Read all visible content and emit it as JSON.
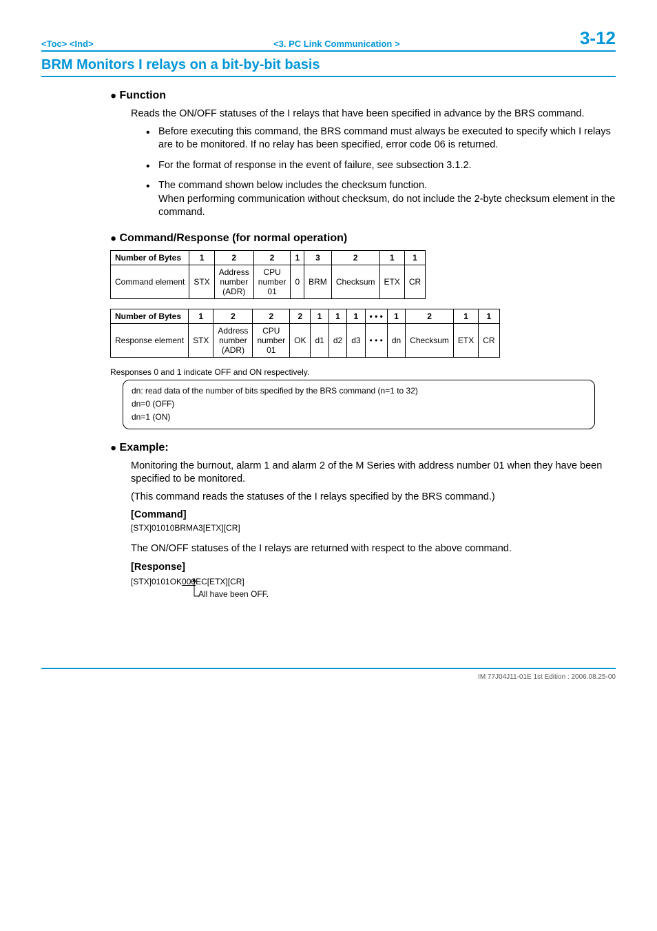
{
  "header": {
    "toc": "<Toc>",
    "ind": "<Ind>",
    "chapter": "<3.  PC Link Communication >",
    "pagenum": "3-12"
  },
  "title": "BRM   Monitors I relays on a bit-by-bit basis",
  "function": {
    "heading": "Function",
    "intro": "Reads the ON/OFF statuses of the I relays that have been specified in advance by the BRS command.",
    "bullets": [
      "Before executing this command, the BRS command must always be executed to specify which I relays are to be monitored. If no relay has been specified, error code 06 is returned.",
      "For the format of response in the event of failure, see subsection 3.1.2.",
      "The command shown below includes the checksum function.\nWhen performing communication without checksum, do not include the 2-byte checksum element in the command."
    ]
  },
  "cmdresp": {
    "heading": "Command/Response (for normal operation)",
    "command_table": {
      "nob_label": "Number of Bytes",
      "elem_label": "Command element",
      "cols": [
        {
          "bytes": "1",
          "val": "STX"
        },
        {
          "bytes": "2",
          "val": "Address number (ADR)"
        },
        {
          "bytes": "2",
          "val": "CPU number 01"
        },
        {
          "bytes": "1",
          "val": "0"
        },
        {
          "bytes": "3",
          "val": "BRM"
        },
        {
          "bytes": "2",
          "val": "Checksum"
        },
        {
          "bytes": "1",
          "val": "ETX"
        },
        {
          "bytes": "1",
          "val": "CR"
        }
      ]
    },
    "response_table": {
      "nob_label": "Number of Bytes",
      "elem_label": "Response element",
      "cols": [
        {
          "bytes": "1",
          "val": "STX"
        },
        {
          "bytes": "2",
          "val": "Address number (ADR)"
        },
        {
          "bytes": "2",
          "val": "CPU number 01"
        },
        {
          "bytes": "2",
          "val": "OK"
        },
        {
          "bytes": "1",
          "val": "d1"
        },
        {
          "bytes": "1",
          "val": "d2"
        },
        {
          "bytes": "1",
          "val": "d3"
        },
        {
          "bytes": "• • •",
          "val": "• • •"
        },
        {
          "bytes": "1",
          "val": "dn"
        },
        {
          "bytes": "2",
          "val": "Checksum"
        },
        {
          "bytes": "1",
          "val": "ETX"
        },
        {
          "bytes": "1",
          "val": "CR"
        }
      ]
    },
    "note": "Responses 0 and 1 indicate OFF and ON respectively.",
    "keybox": {
      "l1": "dn: read data of the number of bits specified by the BRS command (n=1 to 32)",
      "l2": "dn=0 (OFF)",
      "l3": "dn=1 (ON)"
    }
  },
  "example": {
    "heading": "Example:",
    "p1": "Monitoring the burnout, alarm 1 and alarm 2 of the M Series with address number 01 when they have been specified to be monitored.",
    "p2": "(This command reads the statuses of the I relays specified by the BRS command.)",
    "command_label": "[Command]",
    "command_text": "[STX]01010BRMA3[ETX][CR]",
    "p3": "The ON/OFF statuses of the I relays are returned with respect to the above command.",
    "response_label": "[Response]",
    "response_prefix": "[STX]0101OK",
    "response_mid": "000",
    "response_suffix": "EC[ETX][CR]",
    "arrow_text": "All have been OFF."
  },
  "footer": "IM 77J04J11-01E  1st Edition : 2006.08.25-00"
}
